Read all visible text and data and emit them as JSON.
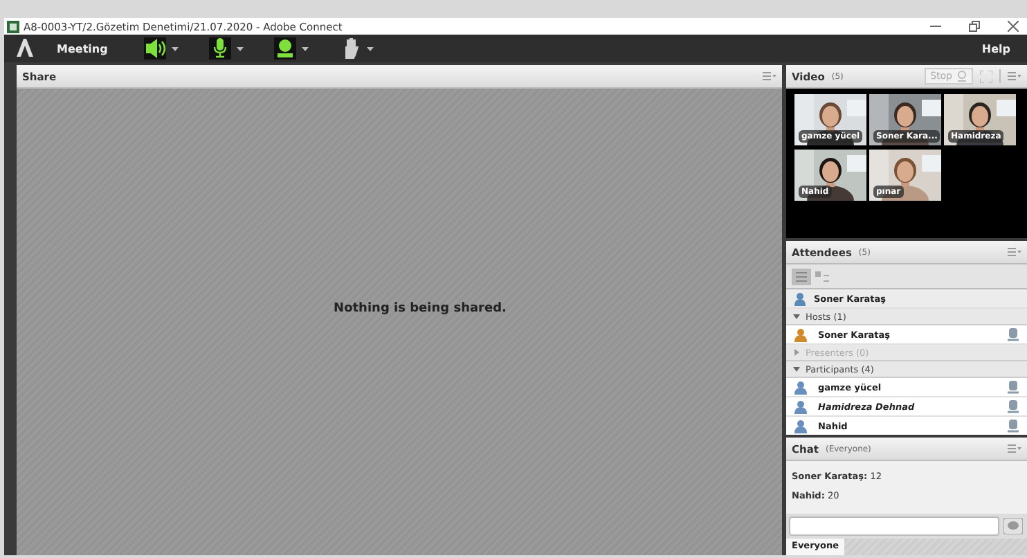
{
  "window": {
    "title": "A8-0003-YT/2.Gözetim Denetimi/21.07.2020 - Adobe Connect"
  },
  "menu_bar": {
    "items": [
      "Meeting"
    ],
    "help": "Help"
  },
  "media_controls": [
    {
      "kind": "speaker",
      "on": true
    },
    {
      "kind": "microphone",
      "on": true
    },
    {
      "kind": "webcam",
      "on": true
    },
    {
      "kind": "hand",
      "on": false
    }
  ],
  "share": {
    "title": "Share",
    "message": "Nothing is being shared."
  },
  "video": {
    "title": "Video",
    "count": "(5)",
    "stop_button": "Stop",
    "tiles": [
      {
        "name": "gamze yücel",
        "kind": "picture"
      },
      {
        "name": "Soner Kara...",
        "kind": "picture"
      },
      {
        "name": "Hamidreza",
        "kind": "picture"
      },
      {
        "name": "Nahid",
        "kind": "picture"
      },
      {
        "name": "pınar",
        "kind": "picture"
      }
    ]
  },
  "attendees": {
    "title": "Attendees",
    "count": "(5)",
    "me": "Soner Karataş",
    "groups": [
      {
        "label": "Hosts (1)",
        "expanded": true,
        "disabled": false,
        "children": [
          {
            "name": "Soner Karataş",
            "kind": "host",
            "italic": false
          }
        ]
      },
      {
        "label": "Presenters (0)",
        "expanded": false,
        "disabled": true
      },
      {
        "label": "Participants (4)",
        "expanded": true,
        "disabled": false,
        "children": [
          {
            "name": "gamze yücel",
            "kind": "participant",
            "italic": false
          },
          {
            "name": "Hamidreza Dehnad",
            "kind": "participant",
            "italic": true
          },
          {
            "name": "Nahid",
            "kind": "participant",
            "italic": false
          }
        ]
      }
    ]
  },
  "chat": {
    "title": "Chat",
    "scope": "(Everyone)",
    "messages": [
      {
        "sender": "Soner Karataş:",
        "text": "12"
      },
      {
        "sender": "Nahid:",
        "text": "20"
      }
    ],
    "tabs": [
      {
        "label": "Everyone",
        "selected": true
      }
    ]
  }
}
